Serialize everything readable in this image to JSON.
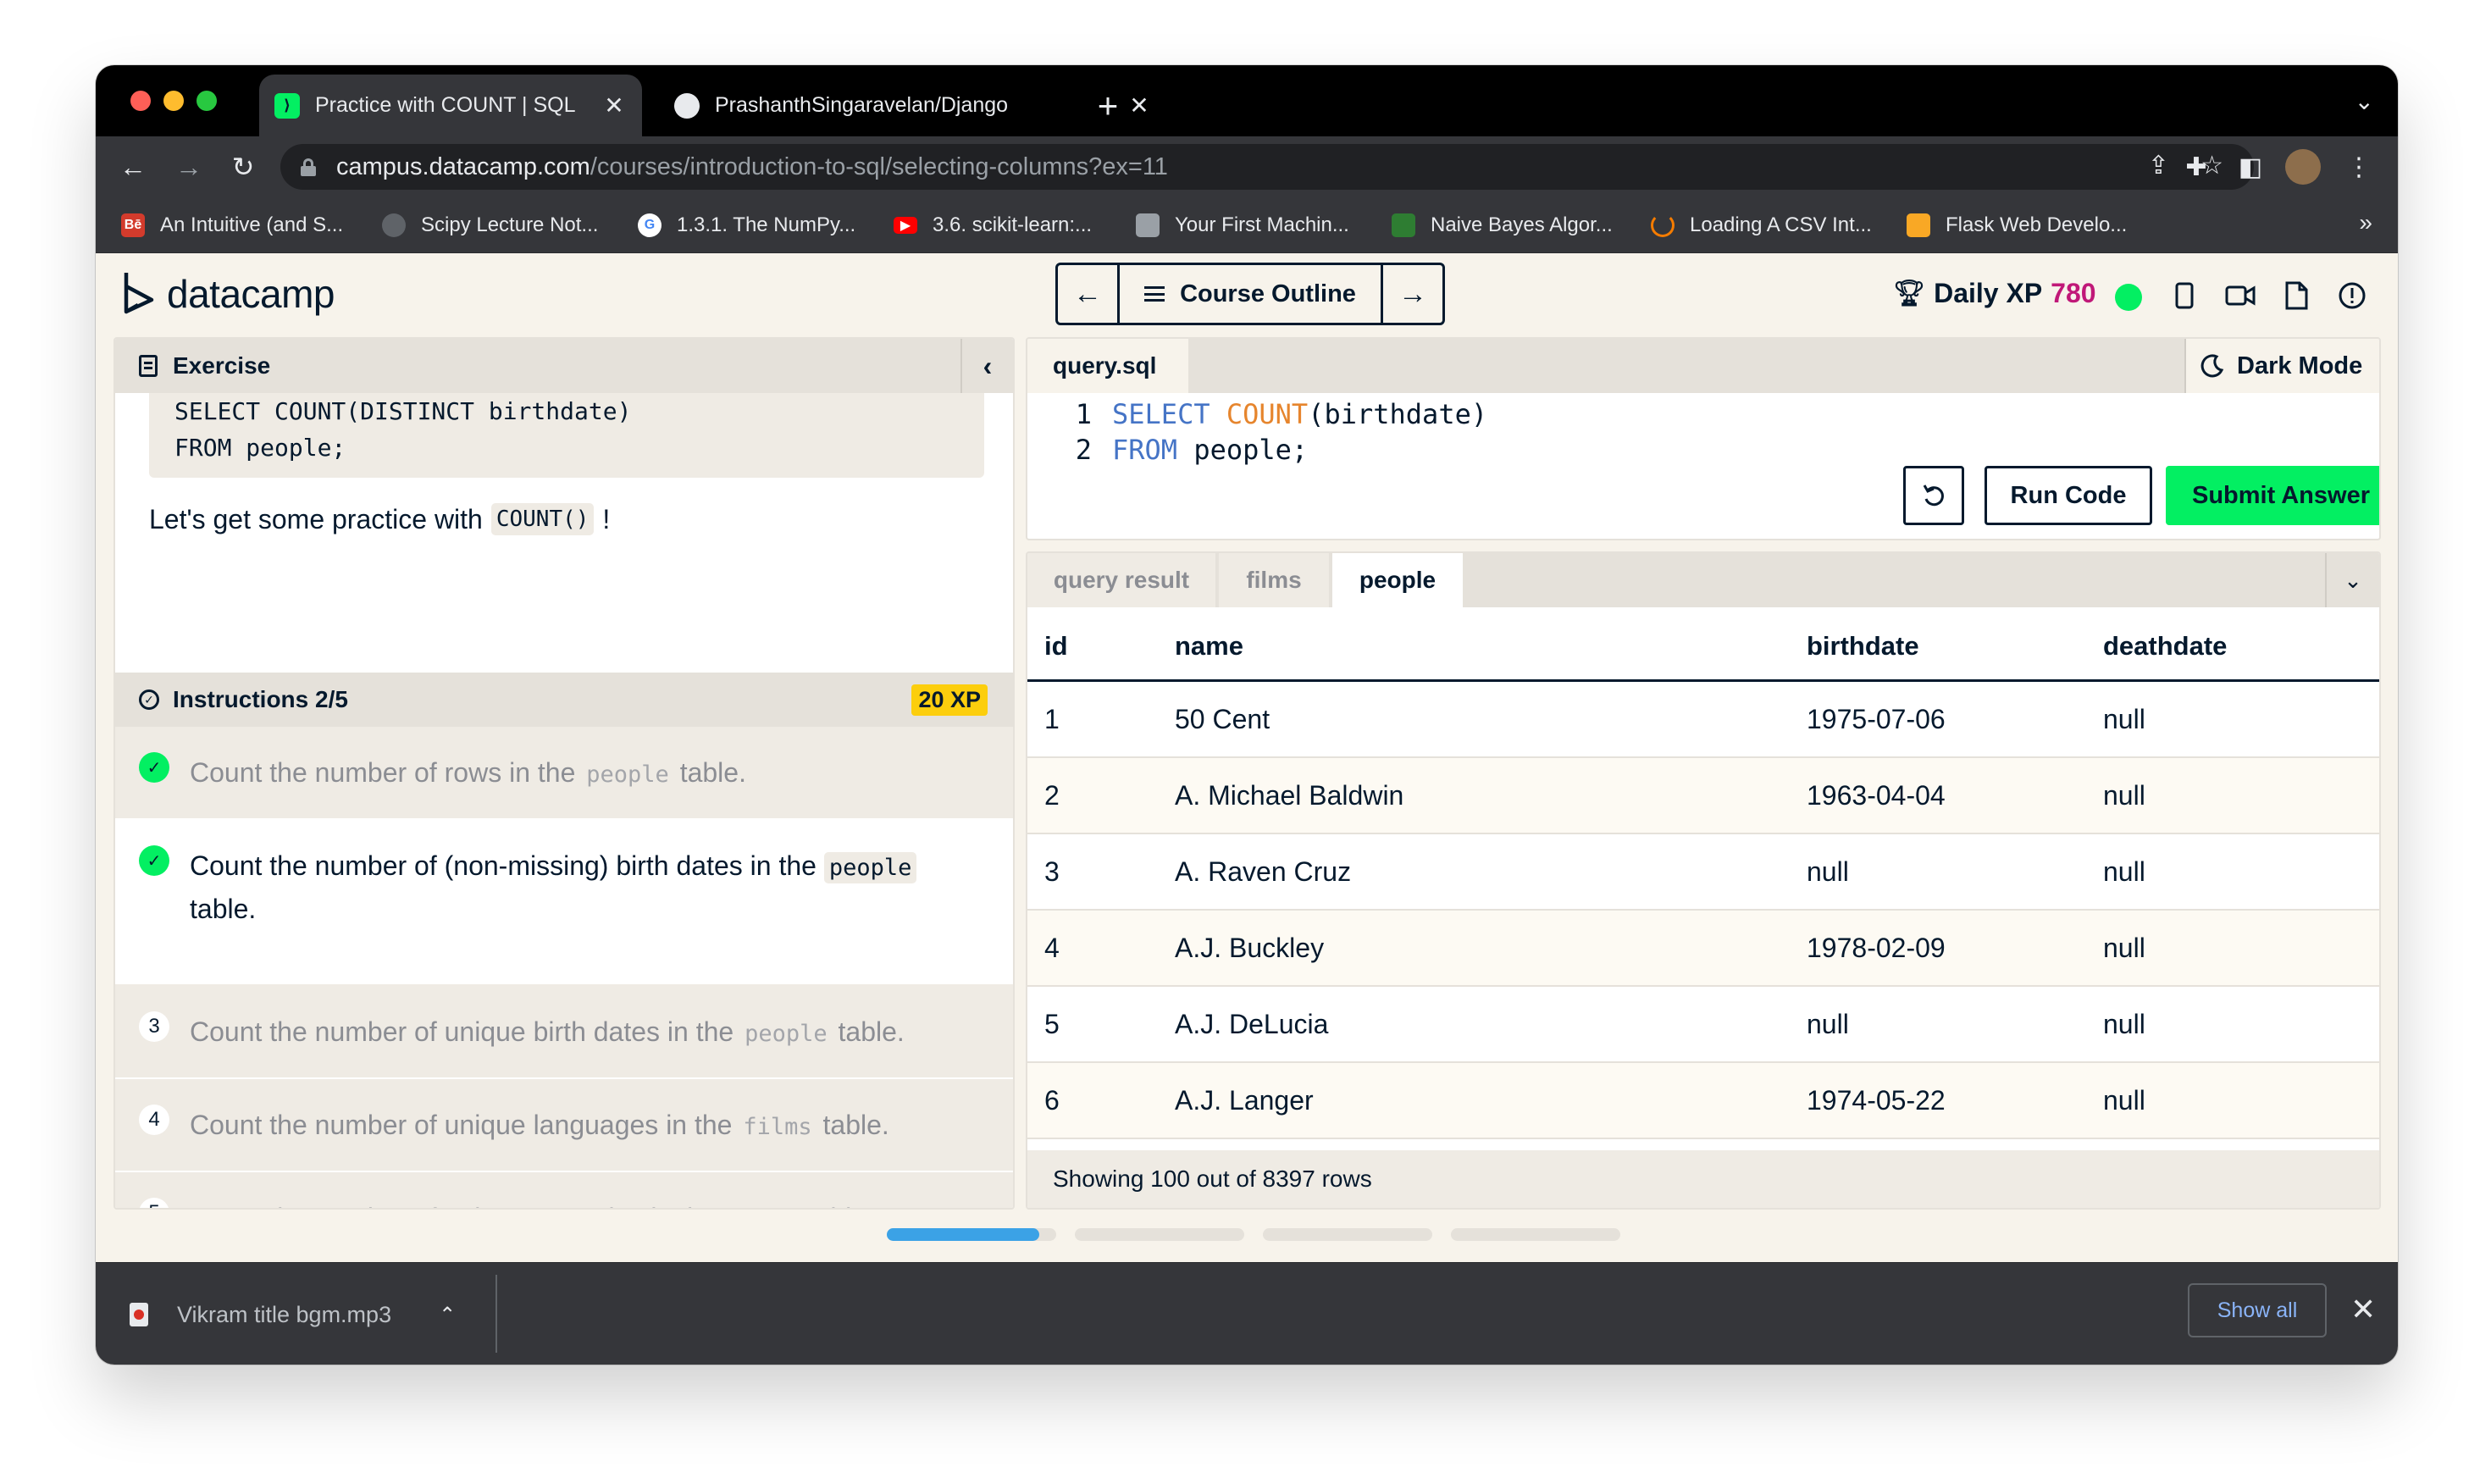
{
  "browser": {
    "tabs": [
      {
        "title": "Practice with COUNT | SQL",
        "active": true
      },
      {
        "title": "PrashanthSingaravelan/Django",
        "active": false
      }
    ],
    "url_host": "campus.datacamp.com",
    "url_path": "/courses/introduction-to-sql/selecting-columns?ex=11",
    "bookmarks": [
      {
        "label": "An Intuitive (and S...",
        "icon": "behance-icon",
        "color": "#d33b2c"
      },
      {
        "label": "Scipy Lecture Not...",
        "icon": "scipy-icon",
        "color": "#5f6368"
      },
      {
        "label": "1.3.1. The NumPy...",
        "icon": "google-icon",
        "color": "#ffffff"
      },
      {
        "label": "3.6. scikit-learn:...",
        "icon": "youtube-icon",
        "color": "#ff0000"
      },
      {
        "label": "Your First Machin...",
        "icon": "site-icon",
        "color": "#9aa0a6"
      },
      {
        "label": "Naive Bayes Algor...",
        "icon": "site-icon",
        "color": "#2e7d32"
      },
      {
        "label": "Loading A CSV Int...",
        "icon": "spinner-icon",
        "color": "#f57c00"
      },
      {
        "label": "Flask Web Develo...",
        "icon": "book-icon",
        "color": "#f9a825"
      }
    ],
    "more_glyph": "»"
  },
  "header": {
    "logo_text": "datacamp",
    "course_outline_label": "Course Outline",
    "daily_xp_label": "Daily XP",
    "daily_xp_value": "780"
  },
  "exercise": {
    "panel_title": "Exercise",
    "code_snippet": "SELECT COUNT(DISTINCT birthdate)\nFROM people;",
    "practice_prefix": "Let's get some practice with",
    "practice_code": "COUNT()",
    "practice_suffix": "!",
    "instructions_title": "Instructions 2/5",
    "xp_badge": "20 XP",
    "steps": [
      {
        "marker": "✓",
        "before": "Count the number of rows in the",
        "code": "people",
        "after": "table.",
        "state": "done"
      },
      {
        "marker": "✓",
        "before": "Count the number of (non-missing) birth dates in the",
        "code": "people",
        "after": "table.",
        "state": "current"
      },
      {
        "marker": "3",
        "before": "Count the number of unique birth dates in the",
        "code": "people",
        "after": "table.",
        "state": "todo"
      },
      {
        "marker": "4",
        "before": "Count the number of unique languages in the",
        "code": "films",
        "after": "table.",
        "state": "todo"
      },
      {
        "marker": "5",
        "before": "Count the number of unique countries in the",
        "code": "films",
        "after": "table.",
        "state": "todo"
      }
    ]
  },
  "editor": {
    "file_tab": "query.sql",
    "dark_mode_label": "Dark Mode",
    "lines": [
      {
        "num": "1",
        "kw": "SELECT",
        "fn": "COUNT",
        "rest": "(birthdate)"
      },
      {
        "num": "2",
        "kw": "FROM",
        "fn": "",
        "rest": "people;"
      }
    ],
    "run_label": "Run Code",
    "submit_label": "Submit Answer"
  },
  "results": {
    "tabs": [
      "query result",
      "films",
      "people"
    ],
    "active_tab": "people",
    "columns": [
      "id",
      "name",
      "birthdate",
      "deathdate"
    ],
    "rows": [
      [
        "1",
        "50 Cent",
        "1975-07-06",
        "null"
      ],
      [
        "2",
        "A. Michael Baldwin",
        "1963-04-04",
        "null"
      ],
      [
        "3",
        "A. Raven Cruz",
        "null",
        "null"
      ],
      [
        "4",
        "A.J. Buckley",
        "1978-02-09",
        "null"
      ],
      [
        "5",
        "A.J. DeLucia",
        "null",
        "null"
      ],
      [
        "6",
        "A.J. Langer",
        "1974-05-22",
        "null"
      ]
    ],
    "footer": "Showing 100 out of 8397 rows"
  },
  "progress": {
    "current_step": 2,
    "total_steps": 5,
    "current_fill": 0.9
  },
  "downloads": {
    "file_name": "Vikram title bgm.mp3",
    "show_all_label": "Show all"
  },
  "colors": {
    "brand_green": "#03ef62",
    "navy": "#05192d",
    "xp_value": "#c01878",
    "keyword": "#4574c6",
    "function": "#e6852d",
    "progress_active": "#3ba2e6"
  }
}
